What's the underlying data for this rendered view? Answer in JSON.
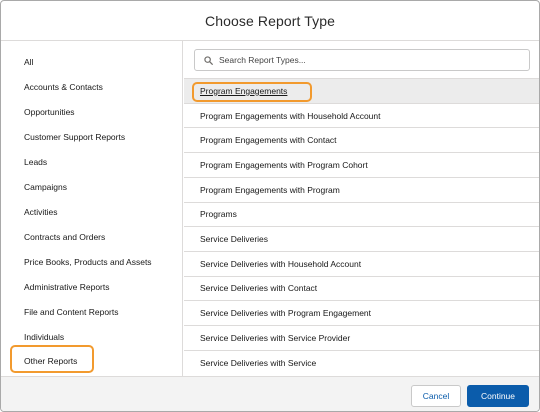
{
  "dialog": {
    "title": "Choose Report Type"
  },
  "sidebar": {
    "items": [
      "All",
      "Accounts & Contacts",
      "Opportunities",
      "Customer Support Reports",
      "Leads",
      "Campaigns",
      "Activities",
      "Contracts and Orders",
      "Price Books, Products and Assets",
      "Administrative Reports",
      "File and Content Reports",
      "Individuals",
      "Other Reports"
    ],
    "selected": "Other Reports"
  },
  "search": {
    "placeholder": "Search Report Types..."
  },
  "report_types": [
    "Program Engagements",
    "Program Engagements with Household Account",
    "Program Engagements with Contact",
    "Program Engagements with Program Cohort",
    "Program Engagements with Program",
    "Programs",
    "Service Deliveries",
    "Service Deliveries with Household Account",
    "Service Deliveries with Contact",
    "Service Deliveries with Program Engagement",
    "Service Deliveries with Service Provider",
    "Service Deliveries with Service"
  ],
  "selected_report_type": "Program Engagements",
  "footer": {
    "cancel_label": "Cancel",
    "continue_label": "Continue"
  },
  "colors": {
    "brand": "#0b5cab",
    "highlight": "#f29a2e"
  }
}
